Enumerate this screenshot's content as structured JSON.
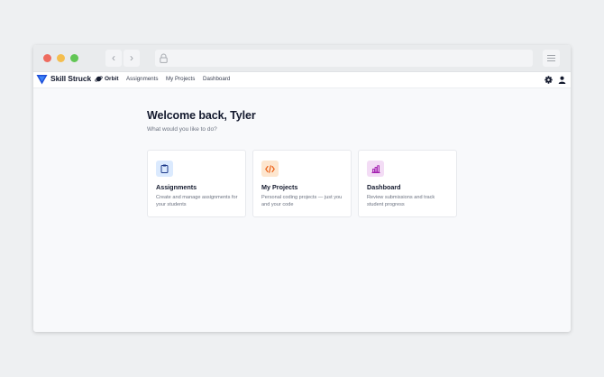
{
  "browser": {
    "back_icon": "chevron-left-icon",
    "forward_icon": "chevron-right-icon",
    "url_icon": "lock-icon",
    "menu_icon": "hamburger-icon"
  },
  "appbar": {
    "brand": "Skill Struck",
    "product": "Orbit",
    "nav": [
      "Assignments",
      "My Projects",
      "Dashboard"
    ],
    "settings_icon": "gear-icon",
    "account_icon": "user-icon",
    "brand_color": "#1d4ed8"
  },
  "main": {
    "title": "Welcome back, Tyler",
    "subtitle": "What would you like to do?",
    "cards": [
      {
        "title": "Assignments",
        "description": "Create and manage assignments for your students",
        "icon": "clipboard-icon",
        "icon_bg": "#dbeafe",
        "icon_color": "#1e3a8a"
      },
      {
        "title": "My Projects",
        "description": "Personal coding projects — just you and your code",
        "icon": "code-icon",
        "icon_bg": "#fde6cf",
        "icon_color": "#ea580c"
      },
      {
        "title": "Dashboard",
        "description": "Review submissions and track student progress",
        "icon": "bar-chart-icon",
        "icon_bg": "#f3dcf5",
        "icon_color": "#a21caf"
      }
    ]
  }
}
